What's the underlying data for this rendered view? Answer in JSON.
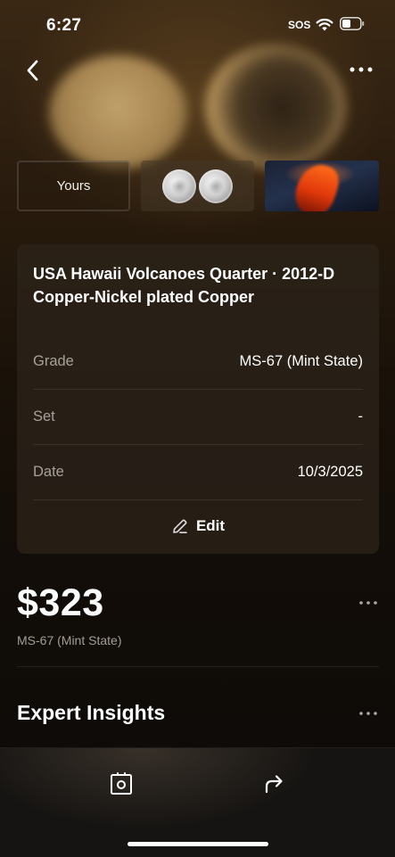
{
  "status_bar": {
    "time": "6:27",
    "sos": "SOS"
  },
  "header": {
    "back_icon": "chevron-left-icon",
    "more_icon": "ellipsis-icon"
  },
  "thumbnails": [
    {
      "label": "Yours",
      "kind": "text"
    },
    {
      "label": "",
      "kind": "coin-images"
    },
    {
      "label": "",
      "kind": "volcano-image"
    }
  ],
  "details": {
    "title": "USA Hawaii Volcanoes Quarter · 2012-D Copper-Nickel plated Copper",
    "rows": [
      {
        "label": "Grade",
        "value": "MS-67 (Mint State)"
      },
      {
        "label": "Set",
        "value": "-"
      },
      {
        "label": "Date",
        "value": "10/3/2025"
      }
    ],
    "edit_label": "Edit"
  },
  "valuation": {
    "price": "$323",
    "grade": "MS-67 (Mint State)"
  },
  "sections": {
    "insights_title": "Expert Insights"
  },
  "toolbar": {
    "capture_icon": "image-scan-icon",
    "share_icon": "share-arrow-icon"
  },
  "colors": {
    "background": "#0d0a07",
    "card": "#2c221a",
    "muted_text": "#a6a19a"
  }
}
